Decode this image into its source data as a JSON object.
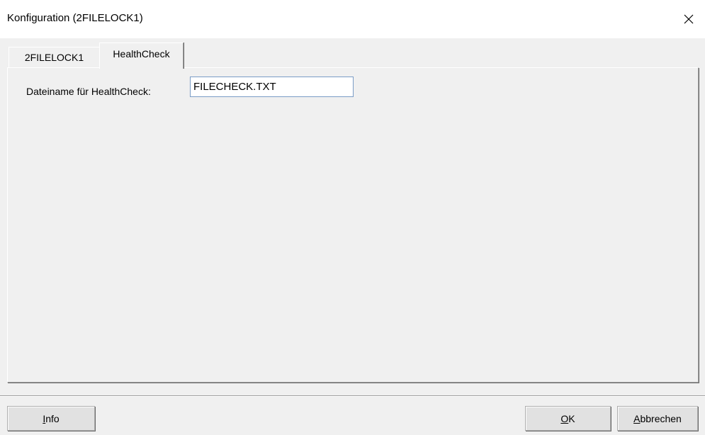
{
  "window": {
    "title": "Konfiguration (2FILELOCK1)",
    "close_icon": "close-icon"
  },
  "tabs": [
    {
      "label": "2FILELOCK1",
      "active": false
    },
    {
      "label": "HealthCheck",
      "active": true
    }
  ],
  "healthcheck": {
    "filename_label": "Dateiname für HealthCheck:",
    "filename_value": "FILECHECK.TXT"
  },
  "buttons": {
    "info": {
      "mnemonic": "I",
      "rest": "nfo"
    },
    "ok": {
      "mnemonic": "O",
      "rest": "K"
    },
    "cancel": {
      "mnemonic": "A",
      "rest": "bbrechen"
    }
  },
  "colors": {
    "dialog_background": "#f0f0f0",
    "titlebar_background": "#ffffff",
    "input_border_focus": "#7a9cc6",
    "button_face": "#e1e1e1"
  }
}
